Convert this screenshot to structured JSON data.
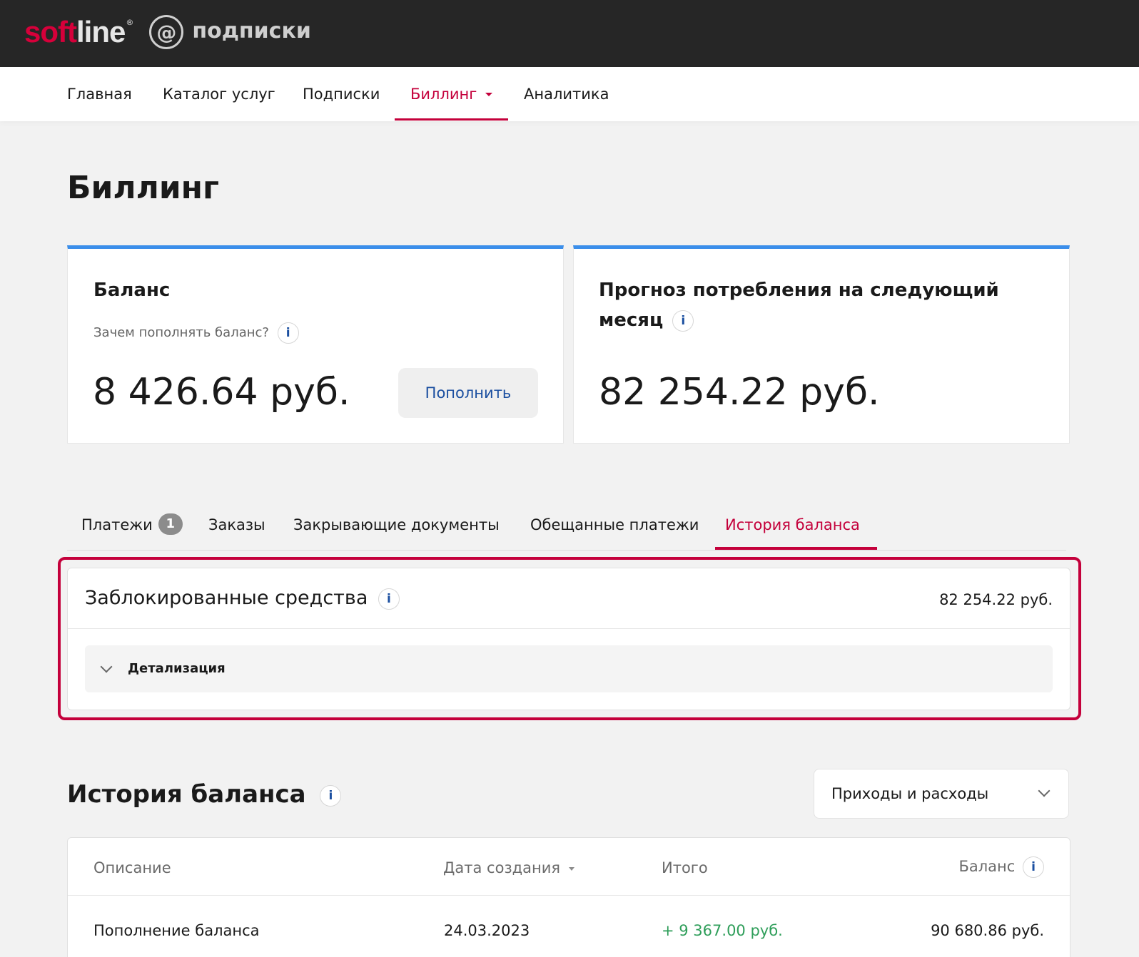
{
  "brand": {
    "logo_soft_red": "soft",
    "logo_soft_white": "line",
    "logo_reg": "®",
    "logo_at": "@",
    "logo_sub": "подписки"
  },
  "nav": {
    "items": [
      {
        "label": "Главная"
      },
      {
        "label": "Каталог услуг"
      },
      {
        "label": "Подписки"
      },
      {
        "label": "Биллинг",
        "active": true
      },
      {
        "label": "Аналитика"
      }
    ]
  },
  "page": {
    "title": "Биллинг"
  },
  "balance_card": {
    "title": "Баланс",
    "subtitle": "Зачем пополнять баланс?",
    "amount": "8 426.64 руб.",
    "button": "Пополнить"
  },
  "forecast_card": {
    "title_line1": "Прогноз потребления на следующий",
    "title_line2": "месяц",
    "amount": "82 254.22 руб."
  },
  "tabs": {
    "items": [
      {
        "label": "Платежи",
        "badge": "1"
      },
      {
        "label": "Заказы"
      },
      {
        "label": "Закрывающие документы"
      },
      {
        "label": "Обещанные платежи"
      },
      {
        "label": "История баланса",
        "active": true
      }
    ]
  },
  "blocked": {
    "title": "Заблокированные средства",
    "amount": "82 254.22 руб.",
    "details_label": "Детализация"
  },
  "history": {
    "title": "История баланса",
    "filter": "Приходы и расходы",
    "columns": [
      "Описание",
      "Дата создания",
      "Итого",
      "Баланс"
    ],
    "rows": [
      {
        "description": "Пополнение баланса",
        "date": "24.03.2023",
        "total": "+ 9 367.00 руб.",
        "balance": "90 680.86 руб."
      }
    ]
  },
  "icons": {
    "info": "i",
    "info_icon_name": "info-icon"
  },
  "colors": {
    "accent": "#c4003b",
    "card_top": "#3b8eea",
    "link": "#1b4fa0",
    "positive": "#2f9e5a",
    "topbar": "#262626"
  }
}
